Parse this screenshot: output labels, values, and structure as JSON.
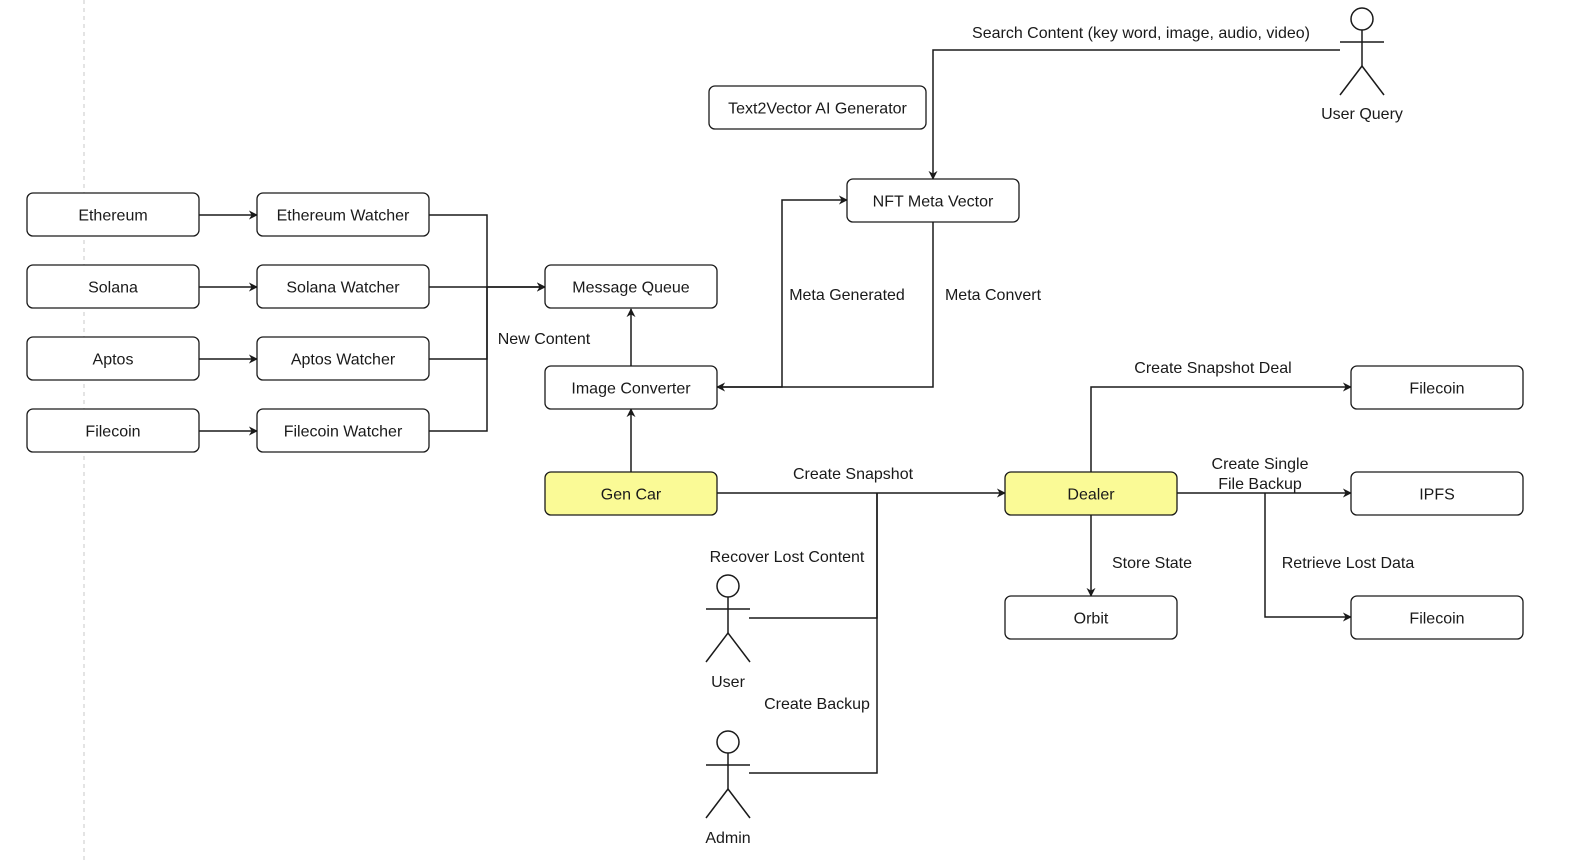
{
  "colors": {
    "stroke": "#1a1a1a",
    "highlight": "#fafa96",
    "box": "#ffffff",
    "divider": "#c8c8c8"
  },
  "nodes": {
    "eth": {
      "label": "Ethereum"
    },
    "sol": {
      "label": "Solana"
    },
    "apt": {
      "label": "Aptos"
    },
    "fil": {
      "label": "Filecoin"
    },
    "ethW": {
      "label": "Ethereum Watcher"
    },
    "solW": {
      "label": "Solana Watcher"
    },
    "aptW": {
      "label": "Aptos Watcher"
    },
    "filW": {
      "label": "Filecoin Watcher"
    },
    "mq": {
      "label": "Message Queue"
    },
    "ic": {
      "label": "Image Converter"
    },
    "gc": {
      "label": "Gen Car",
      "highlighted": true
    },
    "t2v": {
      "label": "Text2Vector AI Generator"
    },
    "nmv": {
      "label": "NFT Meta Vector"
    },
    "dealer": {
      "label": "Dealer",
      "highlighted": true
    },
    "orbit": {
      "label": "Orbit"
    },
    "fil1": {
      "label": "Filecoin"
    },
    "ipfs": {
      "label": "IPFS"
    },
    "fil2": {
      "label": "Filecoin"
    }
  },
  "actors": {
    "userQuery": {
      "label": "User Query"
    },
    "user": {
      "label": "User"
    },
    "admin": {
      "label": "Admin"
    }
  },
  "edge_labels": {
    "newContent": "New Content",
    "metaGenerated": "Meta Generated",
    "metaConvert": "Meta Convert",
    "search": "Search Content (key word, image, audio, video)",
    "createSnapshot": "Create Snapshot",
    "recover": "Recover Lost Content",
    "backup": "Create Backup",
    "snapshotDeal": "Create Snapshot Deal",
    "singleBackup1": "Create Single",
    "singleBackup2": "File Backup",
    "retrieve": "Retrieve Lost Data",
    "storeState": "Store State"
  }
}
